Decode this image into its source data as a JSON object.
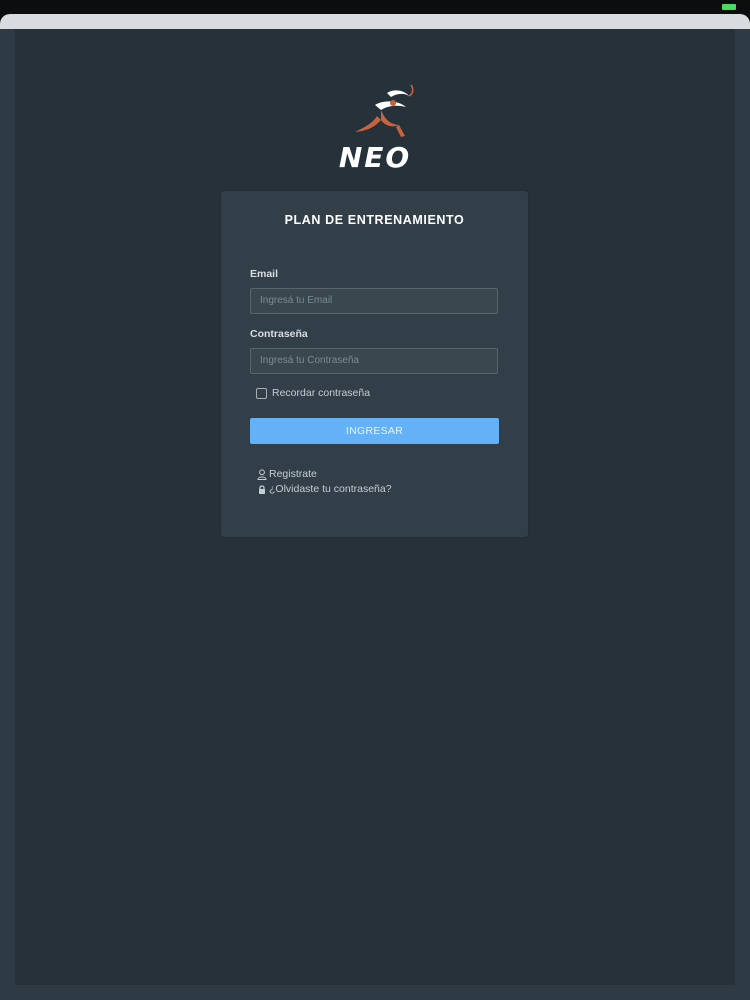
{
  "status_bar": {
    "battery_icon": "battery-icon"
  },
  "logo": {
    "text": "NEO",
    "icon": "runner-logo-icon",
    "colors": {
      "runner": "#c9623f",
      "text": "#ffffff"
    }
  },
  "login": {
    "title": "PLAN DE ENTRENAMIENTO",
    "email": {
      "label": "Email",
      "placeholder": "Ingresá tu Email",
      "value": ""
    },
    "password": {
      "label": "Contraseña",
      "placeholder": "Ingresá tu Contraseña",
      "value": ""
    },
    "remember": {
      "label": "Recordar contraseña",
      "checked": false
    },
    "submit_label": "INGRESAR",
    "register_link": {
      "label": "Registrate",
      "icon": "user-icon"
    },
    "forgot_link": {
      "label": "¿Olvidaste tu contraseña?",
      "icon": "lock-icon"
    }
  },
  "colors": {
    "background": "#27313a",
    "card": "#323f49",
    "accent": "#64b1f7"
  }
}
